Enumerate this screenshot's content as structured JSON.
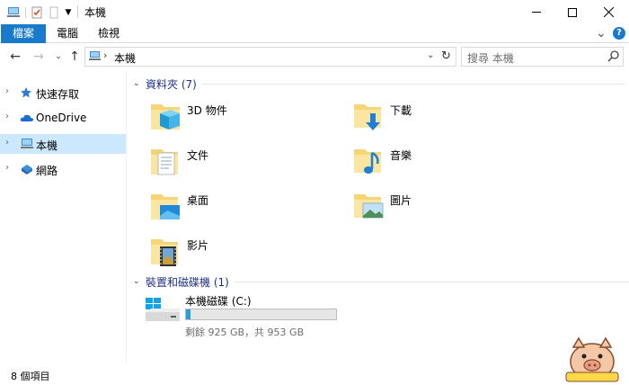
{
  "window": {
    "title": "本機"
  },
  "ribbon": {
    "tabs": [
      "檔案",
      "電腦",
      "檢視"
    ],
    "help": "?"
  },
  "address": {
    "crumb": "本機"
  },
  "search": {
    "placeholder": "搜尋 本機"
  },
  "sidebar": {
    "items": [
      {
        "label": "快速存取",
        "icon": "star-icon"
      },
      {
        "label": "OneDrive",
        "icon": "cloud-icon"
      },
      {
        "label": "本機",
        "icon": "pc-icon",
        "selected": true
      },
      {
        "label": "網路",
        "icon": "network-icon"
      }
    ]
  },
  "groups": {
    "folders_header": "資料夾 (7)",
    "devices_header": "裝置和磁碟機 (1)"
  },
  "folders": [
    {
      "name": "3D 物件",
      "icon": "3d-objects-folder-icon"
    },
    {
      "name": "下載",
      "icon": "downloads-folder-icon"
    },
    {
      "name": "文件",
      "icon": "documents-folder-icon"
    },
    {
      "name": "音樂",
      "icon": "music-folder-icon"
    },
    {
      "name": "桌面",
      "icon": "desktop-folder-icon"
    },
    {
      "name": "圖片",
      "icon": "pictures-folder-icon"
    },
    {
      "name": "影片",
      "icon": "videos-folder-icon"
    }
  ],
  "drive": {
    "name": "本機磁碟 (C:)",
    "free_text": "剩餘 925 GB，共 953 GB",
    "used_fraction": 0.03,
    "bar_color": "#26a0da"
  },
  "status": {
    "text": "8 個項目"
  },
  "colors": {
    "accent": "#1979ca",
    "selection": "#cce8ff",
    "group_header": "#1e3287"
  }
}
